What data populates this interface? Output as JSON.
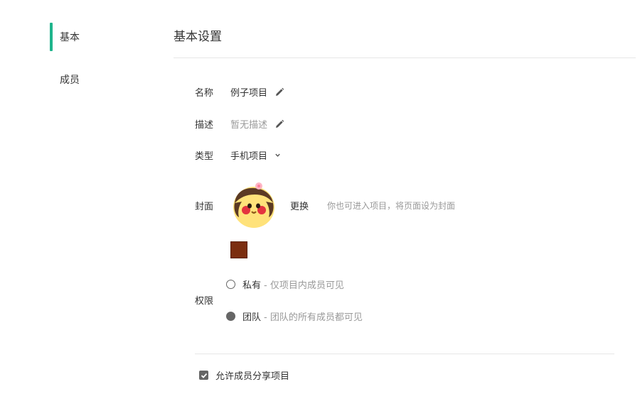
{
  "sidebar": {
    "items": [
      {
        "label": "基本",
        "active": true
      },
      {
        "label": "成员",
        "active": false
      }
    ],
    "accent_color": "#1fb48c"
  },
  "header": {
    "title": "基本设置"
  },
  "form": {
    "name": {
      "label": "名称",
      "value": "例子项目",
      "icon": "pencil-icon"
    },
    "description": {
      "label": "描述",
      "value": "暂无描述",
      "icon": "pencil-icon"
    },
    "type": {
      "label": "类型",
      "value": "手机项目",
      "icon": "chevron-down-icon"
    },
    "cover": {
      "label": "封面",
      "change_label": "更换",
      "hint": "你也可进入项目，将页面设为封面",
      "color": "#7b2e10"
    },
    "permission": {
      "label": "权限",
      "options": [
        {
          "title": "私有",
          "desc": "- 仅项目内成员可见",
          "selected": false
        },
        {
          "title": "团队",
          "desc": "- 团队的所有成员都可见",
          "selected": true
        }
      ]
    },
    "share": {
      "label": "允许成员分享项目",
      "checked": true
    }
  }
}
